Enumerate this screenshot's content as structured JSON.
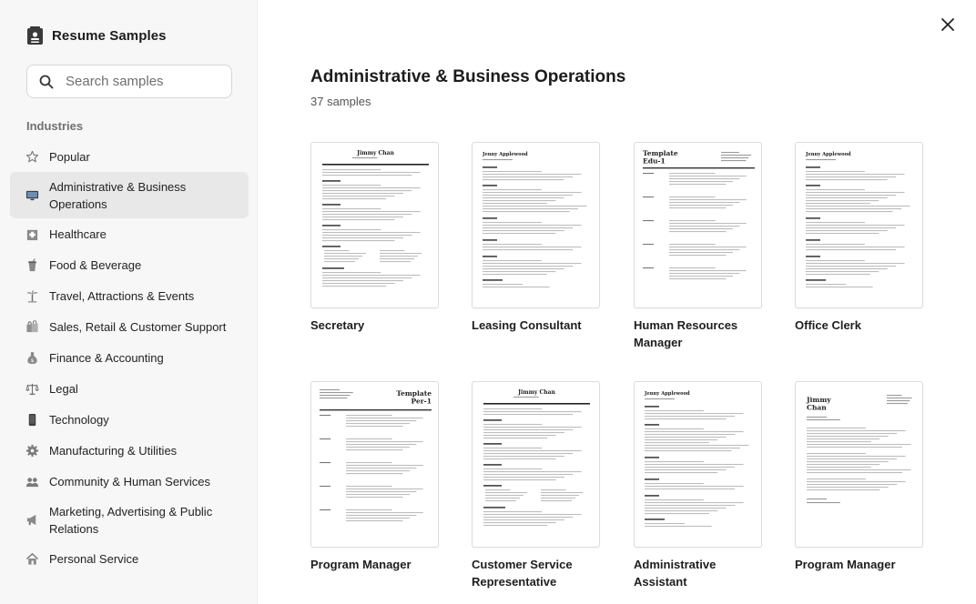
{
  "app": {
    "title": "Resume Samples",
    "brand_icon": "resume-book-icon"
  },
  "search": {
    "placeholder": "Search samples",
    "value": ""
  },
  "sidebar": {
    "section_label": "Industries",
    "items": [
      {
        "label": "Popular",
        "icon": "star-icon",
        "active": false
      },
      {
        "label": "Administrative & Business Operations",
        "icon": "monitor-icon",
        "active": true
      },
      {
        "label": "Healthcare",
        "icon": "hospital-icon",
        "active": false
      },
      {
        "label": "Food & Beverage",
        "icon": "drink-cup-icon",
        "active": false
      },
      {
        "label": "Travel, Attractions & Events",
        "icon": "palm-tree-icon",
        "active": false
      },
      {
        "label": "Sales, Retail & Customer Support",
        "icon": "shopping-bags-icon",
        "active": false
      },
      {
        "label": "Finance & Accounting",
        "icon": "money-bag-icon",
        "active": false
      },
      {
        "label": "Legal",
        "icon": "scales-icon",
        "active": false
      },
      {
        "label": "Technology",
        "icon": "smartphone-icon",
        "active": false
      },
      {
        "label": "Manufacturing & Utilities",
        "icon": "gear-icon",
        "active": false
      },
      {
        "label": "Community & Human Services",
        "icon": "people-icon",
        "active": false
      },
      {
        "label": "Marketing, Advertising & Public Relations",
        "icon": "megaphone-icon",
        "active": false
      },
      {
        "label": "Personal Service",
        "icon": "house-icon",
        "active": false
      }
    ]
  },
  "main": {
    "title": "Administrative & Business Operations",
    "count": "37 samples",
    "close_icon": "close-icon",
    "samples": [
      {
        "title": "Secretary",
        "thumb": {
          "name": "Jimmy Chan",
          "style": "centered"
        }
      },
      {
        "title": "Leasing Consultant",
        "thumb": {
          "name": "Jenny Applewood",
          "style": "left"
        }
      },
      {
        "title": "Human Resources Manager",
        "thumb": {
          "name": "Template\nEdu-1",
          "style": "template"
        }
      },
      {
        "title": "Office Clerk",
        "thumb": {
          "name": "Jenny Applewood",
          "style": "left"
        }
      },
      {
        "title": "Program Manager",
        "thumb": {
          "name": "Template\nPer-1",
          "style": "template-right"
        }
      },
      {
        "title": "Customer Service Representative",
        "thumb": {
          "name": "Jimmy Chan",
          "style": "centered"
        }
      },
      {
        "title": "Administrative Assistant",
        "thumb": {
          "name": "Jenny Applewood",
          "style": "left"
        }
      },
      {
        "title": "Program Manager",
        "thumb": {
          "name": "Jimmy\nChan",
          "style": "letter"
        }
      }
    ]
  }
}
